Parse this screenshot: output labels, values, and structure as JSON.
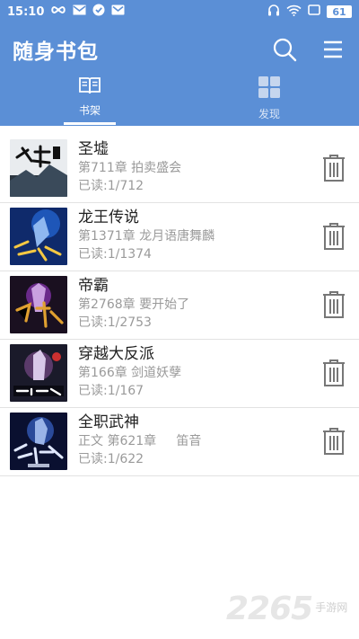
{
  "status_bar": {
    "time": "15:10",
    "battery": "61",
    "left_icons": [
      "infinity-icon",
      "mail-icon",
      "check-shield-icon",
      "gmail-icon"
    ],
    "right_icons": [
      "headphones-icon",
      "wifi-icon",
      "screen-icon"
    ]
  },
  "header": {
    "title": "随身书包",
    "icons": [
      "search-icon",
      "menu-icon"
    ],
    "color": "#5b8fd6"
  },
  "tabs": [
    {
      "label": "书架",
      "icon": "book-icon",
      "active": true
    },
    {
      "label": "发现",
      "icon": "grid-icon",
      "active": false
    }
  ],
  "books": [
    {
      "title": "圣墟",
      "chapter": "第711章 拍卖盛会",
      "progress": "已读:1/712",
      "cover_colors": [
        "#f2f2f2",
        "#3a4a5a",
        "#111111"
      ]
    },
    {
      "title": "龙王传说",
      "chapter": "第1371章 龙月语唐舞麟",
      "progress": "已读:1/1374",
      "cover_colors": [
        "#0f2a6b",
        "#1e56b8",
        "#f5c842"
      ]
    },
    {
      "title": "帝霸",
      "chapter": "第2768章 要开始了",
      "progress": "已读:1/2753",
      "cover_colors": [
        "#1a1020",
        "#6a2a8a",
        "#e0a030"
      ]
    },
    {
      "title": "穿越大反派",
      "chapter": "第166章 剑道妖孽",
      "progress": "已读:1/167",
      "cover_colors": [
        "#1a1a2a",
        "#5a3a6a",
        "#cc3030"
      ]
    },
    {
      "title": "全职武神",
      "chapter": "正文 第621章     笛音",
      "progress": "已读:1/622",
      "cover_colors": [
        "#0a1030",
        "#2a4a9a",
        "#e0e8ff"
      ]
    }
  ],
  "watermark": {
    "number": "2265",
    "suffix": ".com",
    "site": "手游网"
  }
}
